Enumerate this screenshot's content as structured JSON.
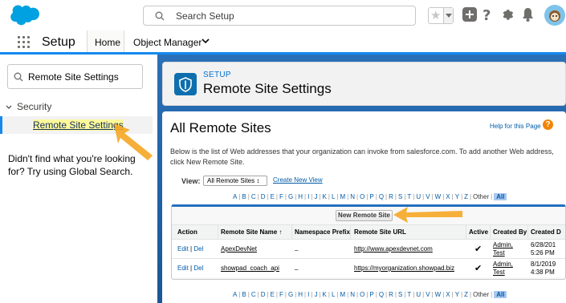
{
  "global_header": {
    "search_placeholder": "Search Setup"
  },
  "app_nav": {
    "app_name": "Setup",
    "tabs": [
      {
        "label": "Home"
      },
      {
        "label": "Object Manager"
      }
    ]
  },
  "left_panel": {
    "quick_find_value": "Remote Site Settings",
    "section_label": "Security",
    "active_item": "Remote Site Settings",
    "not_found_text": "Didn't find what you're looking for? Try using Global Search."
  },
  "page_header": {
    "kicker": "SETUP",
    "title": "Remote Site Settings"
  },
  "content": {
    "heading": "All Remote Sites",
    "help_link": "Help for this Page",
    "help_icon": "?",
    "description": "Below is the list of Web addresses that your organization can invoke from salesforce.com. To add another Web address, click New Remote Site.",
    "view_label": "View:",
    "view_value": "All Remote Sites ↕",
    "create_view": "Create New View",
    "alpha": [
      "A",
      "B",
      "C",
      "D",
      "E",
      "F",
      "G",
      "H",
      "I",
      "J",
      "K",
      "L",
      "M",
      "N",
      "O",
      "P",
      "Q",
      "R",
      "S",
      "T",
      "U",
      "V",
      "W",
      "X",
      "Y",
      "Z"
    ],
    "alpha_other": "Other",
    "alpha_all": "All",
    "new_button": "New Remote Site",
    "columns": [
      "Action",
      "Remote Site Name ↑",
      "Namespace Prefix",
      "Remote Site URL",
      "Active",
      "Created By",
      "Created D"
    ],
    "rows": [
      {
        "edit": "Edit",
        "del": "Del",
        "name": "ApexDevNet",
        "ns": "_",
        "url": "http://www.apexdevnet.com",
        "active": "✔",
        "by1": "Admin,",
        "by2": "Test",
        "date1": "6/28/201",
        "date2": "5:26 PM"
      },
      {
        "edit": "Edit",
        "del": "Del",
        "name": "showpad_coach_api",
        "ns": "_",
        "url": "https://myorganization.showpad.biz",
        "active": "✔",
        "by1": "Admin,",
        "by2": "Test",
        "date1": "8/1/2019",
        "date2": "4:38 PM"
      }
    ]
  },
  "colors": {
    "brand_blue": "#1589ee",
    "setup_bg": "#1b5a9c",
    "annotation_arrow": "#f5a623"
  }
}
